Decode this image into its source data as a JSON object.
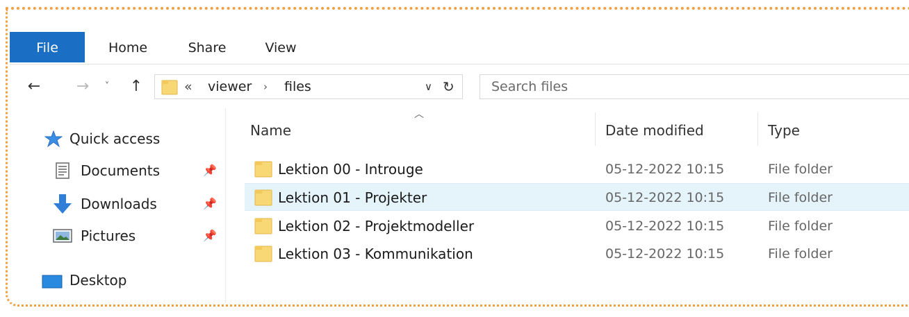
{
  "ribbon": {
    "tabs": [
      {
        "label": "File"
      },
      {
        "label": "Home"
      },
      {
        "label": "Share"
      },
      {
        "label": "View"
      }
    ]
  },
  "address": {
    "overflow": "«",
    "crumbs": [
      "viewer",
      "files"
    ],
    "separator": "›"
  },
  "search": {
    "placeholder": "Search files"
  },
  "sidebar": {
    "items": [
      {
        "label": "Quick access",
        "icon": "star-icon",
        "pinned": false
      },
      {
        "label": "Documents",
        "icon": "documents-icon",
        "pinned": true
      },
      {
        "label": "Downloads",
        "icon": "download-arrow-icon",
        "pinned": true
      },
      {
        "label": "Pictures",
        "icon": "pictures-icon",
        "pinned": true
      },
      {
        "label": "Desktop",
        "icon": "desktop-icon",
        "pinned": false
      }
    ]
  },
  "columns": {
    "name": "Name",
    "date": "Date modified",
    "type": "Type"
  },
  "files": [
    {
      "name": "Lektion 00 - Introuge",
      "date": "05-12-2022 10:15",
      "type": "File folder",
      "selected": false
    },
    {
      "name": "Lektion 01 - Projekter",
      "date": "05-12-2022 10:15",
      "type": "File folder",
      "selected": true
    },
    {
      "name": "Lektion 02 - Projektmodeller",
      "date": "05-12-2022 10:15",
      "type": "File folder",
      "selected": false
    },
    {
      "name": "Lektion 03 - Kommunikation",
      "date": "05-12-2022 10:15",
      "type": "File folder",
      "selected": false
    }
  ],
  "colors": {
    "accent": "#1a6ec4",
    "selection": "#e5f3fb",
    "folder": "#f8d775",
    "frame": "#f0a040"
  }
}
